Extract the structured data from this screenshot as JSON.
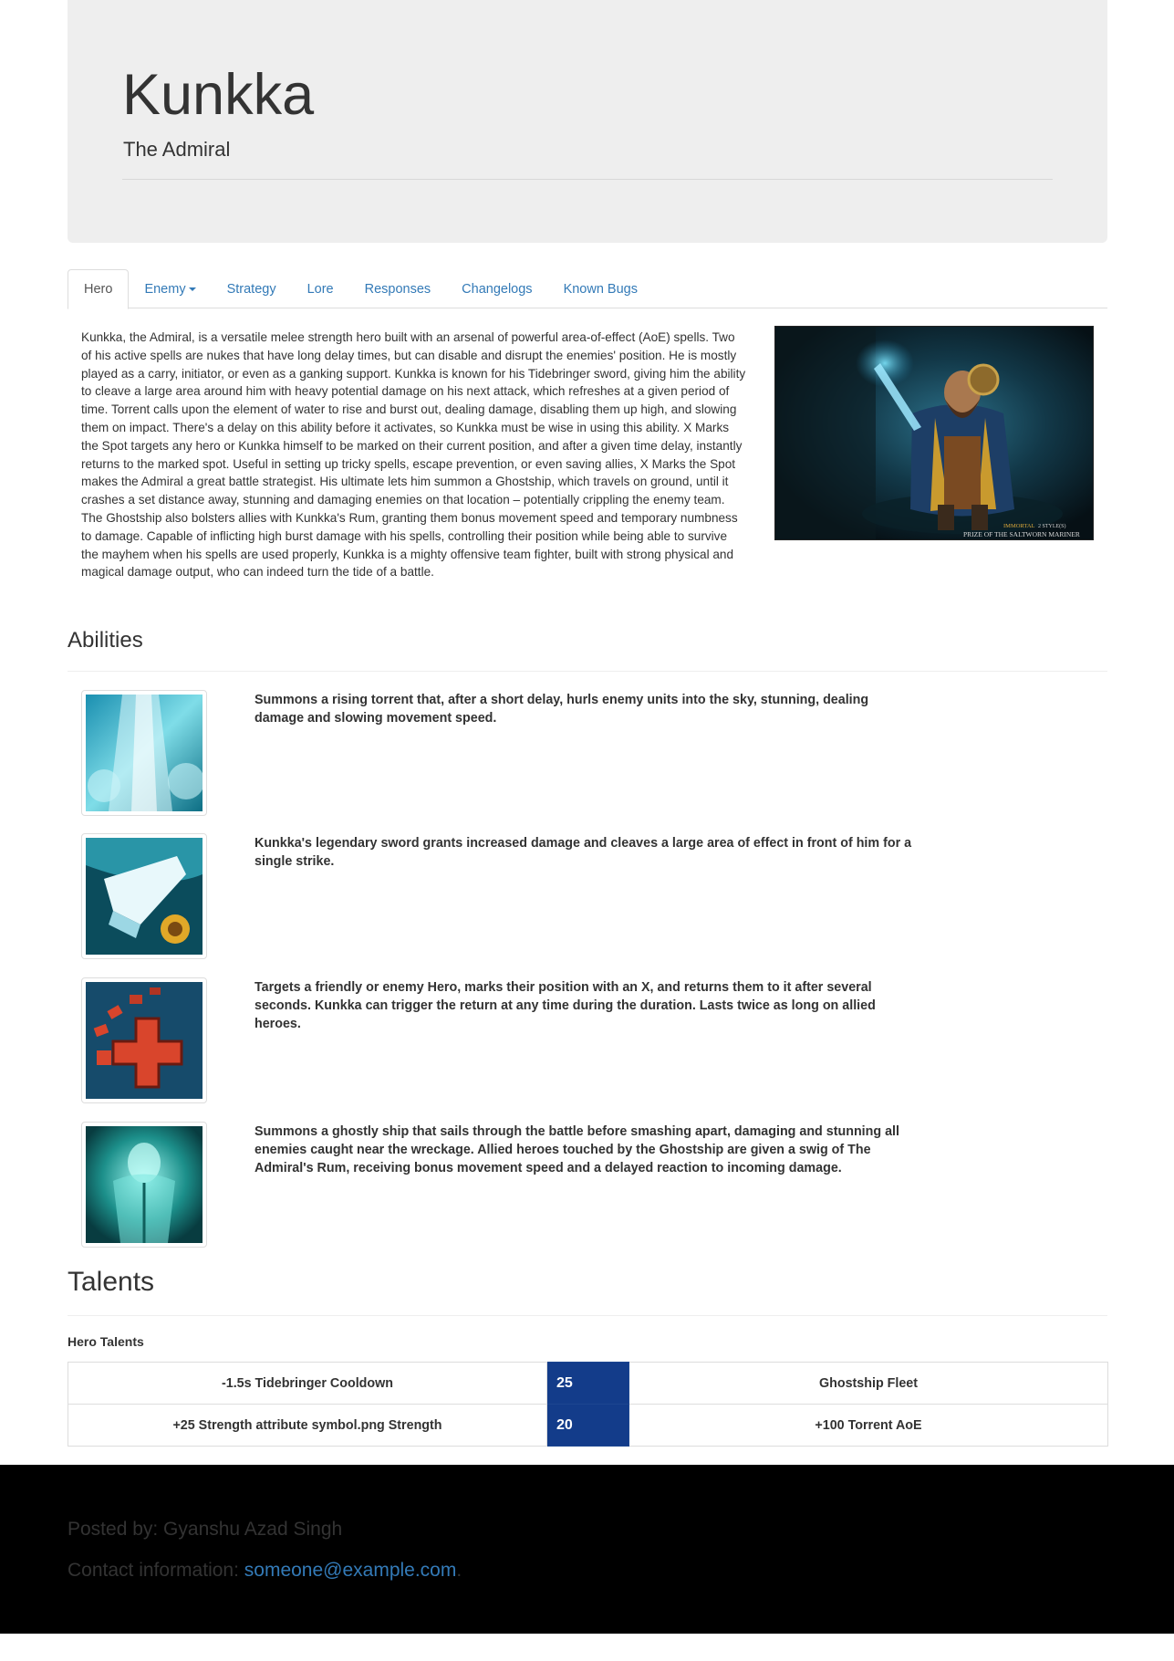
{
  "header": {
    "title": "Kunkka",
    "subtitle": "The Admiral"
  },
  "tabs": [
    {
      "label": "Hero",
      "active": true
    },
    {
      "label": "Enemy",
      "dropdown": true
    },
    {
      "label": "Strategy"
    },
    {
      "label": "Lore"
    },
    {
      "label": "Responses"
    },
    {
      "label": "Changelogs"
    },
    {
      "label": "Known Bugs"
    }
  ],
  "hero": {
    "description": "Kunkka, the Admiral, is a versatile melee strength hero built with an arsenal of powerful area-of-effect (AoE) spells. Two of his active spells are nukes that have long delay times, but can disable and disrupt the enemies' position. He is mostly played as a carry, initiator, or even as a ganking support. Kunkka is known for his Tidebringer sword, giving him the ability to cleave a large area around him with heavy potential damage on his next attack, which refreshes at a given period of time. Torrent calls upon the element of water to rise and burst out, dealing damage, disabling them up high, and slowing them on impact. There's a delay on this ability before it activates, so Kunkka must be wise in using this ability. X Marks the Spot targets any hero or Kunkka himself to be marked on their current position, and after a given time delay, instantly returns to the marked spot. Useful in setting up tricky spells, escape prevention, or even saving allies, X Marks the Spot makes the Admiral a great battle strategist. His ultimate lets him summon a Ghostship, which travels on ground, until it crashes a set distance away, stunning and damaging enemies on that location – potentially crippling the enemy team. The Ghostship also bolsters allies with Kunkka's Rum, granting them bonus movement speed and temporary numbness to damage. Capable of inflicting high burst damage with his spells, controlling their position while being able to survive the mayhem when his spells are used properly, Kunkka is a mighty offensive team fighter, built with strong physical and magical damage output, who can indeed turn the tide of a battle.",
    "image_caption_tag": "IMMORTAL",
    "image_caption_styles": "2 STYLE(S)",
    "image_caption_name": "PRIZE OF THE SALTWORN MARINER"
  },
  "abilities": {
    "heading": "Abilities",
    "items": [
      {
        "icon": "torrent-icon",
        "description": "Summons a rising torrent that, after a short delay, hurls enemy units into the sky, stunning, dealing damage and slowing movement speed."
      },
      {
        "icon": "tidebringer-icon",
        "description": "Kunkka's legendary sword grants increased damage and cleaves a large area of effect in front of him for a single strike."
      },
      {
        "icon": "x-marks-the-spot-icon",
        "description": "Targets a friendly or enemy Hero, marks their position with an X, and returns them to it after several seconds. Kunkka can trigger the return at any time during the duration. Lasts twice as long on allied heroes."
      },
      {
        "icon": "ghostship-icon",
        "description": "Summons a ghostly ship that sails through the battle before smashing apart, damaging and stunning all enemies caught near the wreckage. Allied heroes touched by the Ghostship are given a swig of The Admiral's Rum, receiving bonus movement speed and a delayed reaction to incoming damage."
      }
    ]
  },
  "talents": {
    "heading": "Talents",
    "label": "Hero Talents",
    "rows": [
      {
        "left": "-1.5s Tidebringer Cooldown",
        "level": "25",
        "right": "Ghostship Fleet"
      },
      {
        "left": "+25 Strength attribute symbol.png Strength",
        "level": "20",
        "right": "+100 Torrent AoE"
      }
    ]
  },
  "footer": {
    "posted_by": "Posted by: Gyanshu Azad Singh",
    "contact_label": "Contact information: ",
    "contact_email": "someone@example.com",
    "contact_suffix": "."
  },
  "colors": {
    "link": "#337ab7",
    "jumbotron_bg": "#eeeeee",
    "talent_level_bg": "#133c8a",
    "footer_bg": "#000000"
  }
}
